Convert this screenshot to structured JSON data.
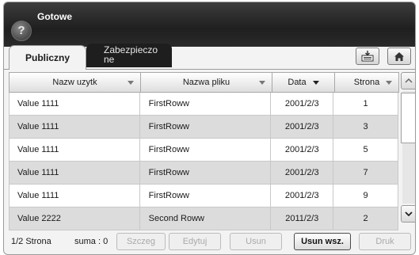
{
  "header": {
    "title": "Gotowe",
    "help_icon": "?"
  },
  "tabs": [
    {
      "label": "Publiczny"
    },
    {
      "label_line1": "Zabezpieczo",
      "label_line2": "ne"
    }
  ],
  "toolbar": {
    "import_icon": "import-icon",
    "home_icon": "home-icon"
  },
  "table": {
    "columns": [
      "Nazw uzytk",
      "Nazwa pliku",
      "Data",
      "Strona"
    ],
    "sorted_column": "Data",
    "rows": [
      {
        "user": "Value 1111",
        "file": "FirstRoww",
        "date": "2001/2/3",
        "page": "1"
      },
      {
        "user": "Value 1111",
        "file": "FirstRoww",
        "date": "2001/2/3",
        "page": "3"
      },
      {
        "user": "Value 1111",
        "file": "FirstRoww",
        "date": "2001/2/3",
        "page": "5"
      },
      {
        "user": "Value 1111",
        "file": "FirstRoww",
        "date": "2001/2/3",
        "page": "7"
      },
      {
        "user": "Value 1111",
        "file": "FirstRoww",
        "date": "2001/2/3",
        "page": "9"
      },
      {
        "user": "Value 2222",
        "file": "Second Roww",
        "date": "2011/2/3",
        "page": "2"
      }
    ]
  },
  "footer": {
    "page_info": "1/2 Strona",
    "sum": "suma : 0",
    "buttons": {
      "details": "Szczeg",
      "edit": "Edytuj",
      "delete": "Usun",
      "delete_all": "Usun wsz.",
      "print": "Druk"
    }
  },
  "colors": {
    "header_bg": "#2a2a2a",
    "row_alt": "#dcdcdc",
    "disabled_text": "#a9a9a9"
  }
}
